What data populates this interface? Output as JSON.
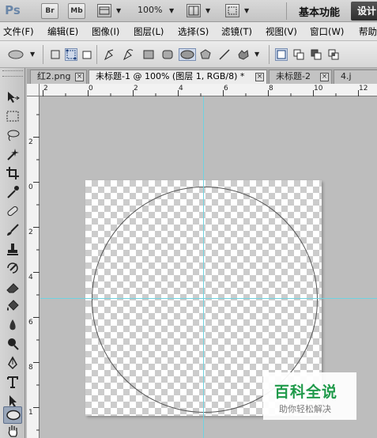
{
  "app": {
    "logo": "Ps",
    "bridge_label": "Br",
    "minibridge_label": "Mb",
    "zoom_level": "100%",
    "workspace_label": "基本功能",
    "design_label": "设计"
  },
  "menubar": {
    "items": [
      "文件(F)",
      "编辑(E)",
      "图像(I)",
      "图层(L)",
      "选择(S)",
      "滤镜(T)",
      "视图(V)",
      "窗口(W)",
      "帮助"
    ]
  },
  "options_bar": {
    "tools": [
      "ellipse-preset-icon",
      "shape-layers-icon",
      "paths-icon",
      "fill-pixels-icon",
      "pen-icon",
      "freeform-pen-icon",
      "rectangle-icon",
      "rounded-rectangle-icon",
      "ellipse-icon",
      "polygon-icon",
      "line-icon",
      "custom-shape-icon",
      "new-layer-icon",
      "add-to-shape-icon",
      "subtract-icon",
      "intersect-icon"
    ],
    "selected": "ellipse-icon"
  },
  "tabs": [
    {
      "label": "红2.png",
      "active": false
    },
    {
      "label": "未标题-1 @ 100% (图层 1, RGB/8) *",
      "active": true
    },
    {
      "label": "未标题-2",
      "active": false
    },
    {
      "label": "4.j",
      "active": false
    }
  ],
  "ruler": {
    "h_numbers": [
      "2",
      "0",
      "2",
      "4",
      "6",
      "8",
      "10",
      "12"
    ],
    "v_numbers": [
      "2",
      "0",
      "2",
      "4",
      "6",
      "8",
      "1"
    ]
  },
  "toolbox": {
    "tools": [
      "move-tool-icon",
      "marquee-tool-icon",
      "lasso-tool-icon",
      "quick-select-icon",
      "crop-tool-icon",
      "eyedropper-icon",
      "healing-brush-icon",
      "brush-tool-icon",
      "clone-stamp-icon",
      "history-brush-icon",
      "eraser-icon",
      "paint-bucket-icon",
      "blur-tool-icon",
      "dodge-tool-icon",
      "pen-tool-icon",
      "type-tool-icon",
      "path-select-icon",
      "ellipse-tool-icon",
      "hand-tool-icon"
    ],
    "selected": "ellipse-tool-icon"
  },
  "watermark": {
    "title": "百科全说",
    "subtitle": "助你轻松解决"
  },
  "colors": {
    "guide": "#6fd3e0",
    "watermark_green": "#1f9a4a"
  }
}
